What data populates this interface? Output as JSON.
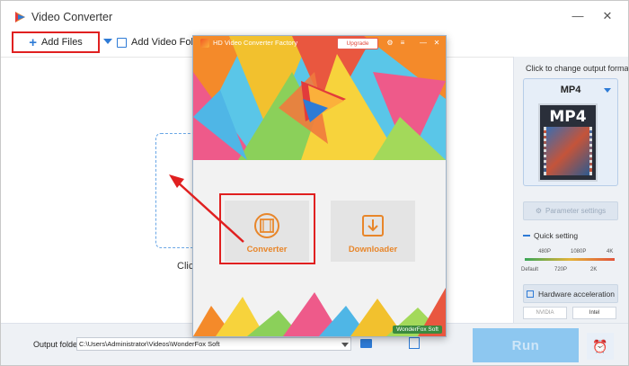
{
  "window": {
    "title": "Video Converter"
  },
  "toolbar": {
    "add_files_label": "Add Files",
    "add_folder_label": "Add Video Folder"
  },
  "main": {
    "click_text": "Click"
  },
  "right_panel": {
    "hint": "Click to change output format:",
    "format_name": "MP4",
    "format_thumb_label": "MP4",
    "parameter_settings": "Parameter settings",
    "quick_setting": "Quick setting",
    "res_top": [
      "480P",
      "1080P",
      "4K"
    ],
    "res_bottom": [
      "Default",
      "720P",
      "2K"
    ],
    "hardware_acceleration": "Hardware acceleration",
    "gpu": [
      "NVIDIA",
      "Intel"
    ]
  },
  "bottom": {
    "output_folder_label": "Output folder:",
    "output_folder_value": "C:\\Users\\Administrator\\Videos\\WonderFox Soft",
    "run_label": "Run"
  },
  "modal": {
    "title": "HD Video Converter Factory",
    "upgrade_label": "Upgrade",
    "converter_label": "Converter",
    "downloader_label": "Downloader",
    "brand": "WonderFox Soft"
  },
  "colors": {
    "accent": "#2e7bd6",
    "highlight_red": "#e02020",
    "tile_text": "#e8862a",
    "run": "#8dc7f0"
  }
}
